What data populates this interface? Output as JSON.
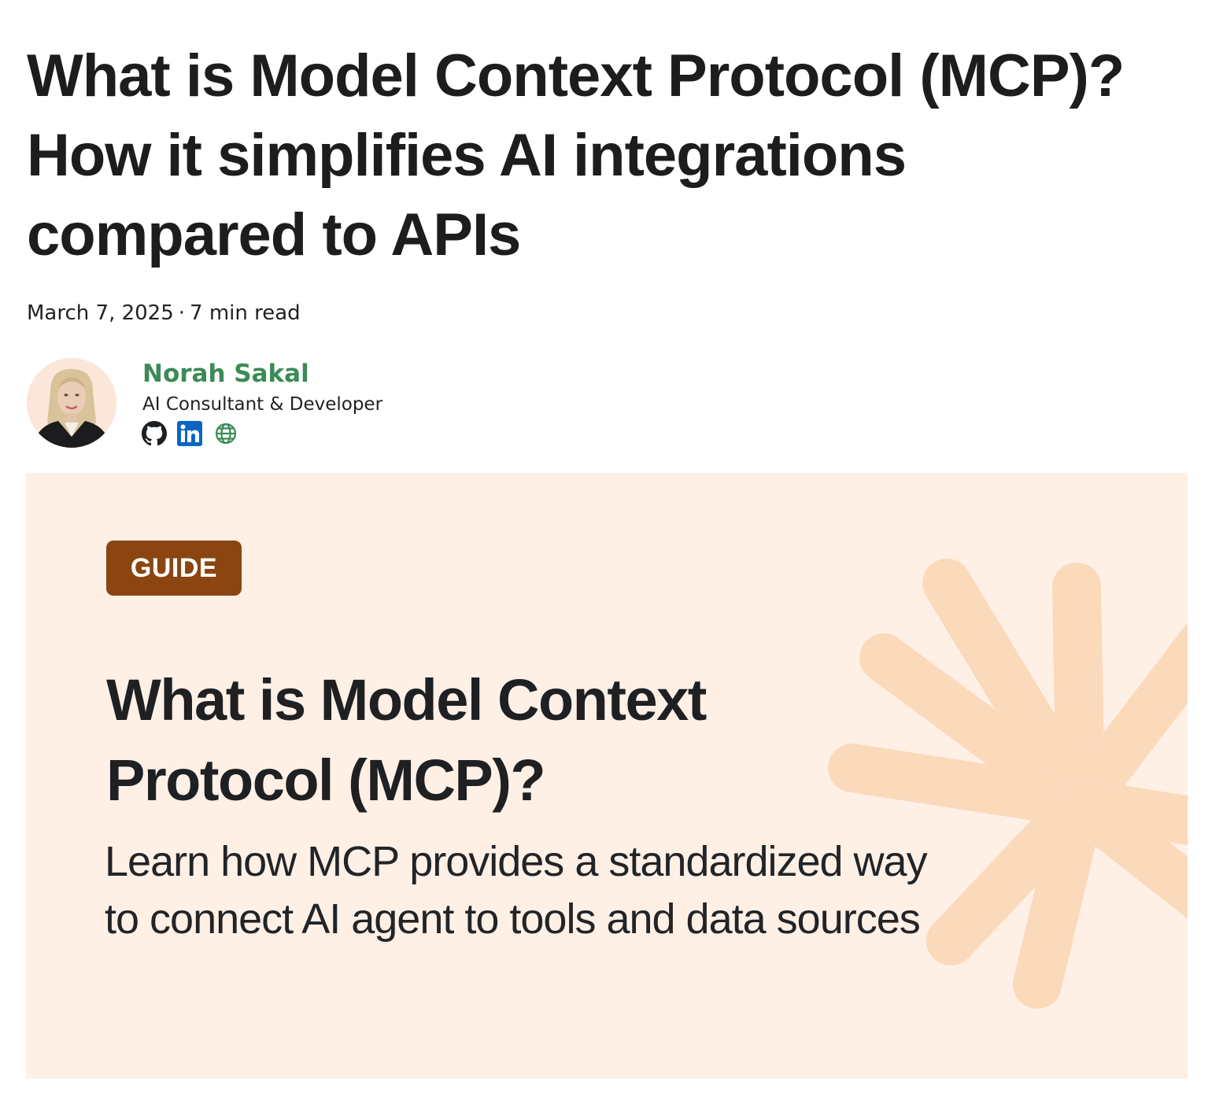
{
  "article": {
    "title": "What is Model Context Protocol (MCP)? How it simplifies AI integrations compared to APIs",
    "date": "March 7, 2025",
    "separator": "·",
    "read_time": "7 min read"
  },
  "author": {
    "name": "Norah Sakal",
    "role": "AI Consultant & Developer",
    "avatar_icon": "avatar",
    "links": [
      {
        "icon": "github-icon"
      },
      {
        "icon": "linkedin-icon"
      },
      {
        "icon": "globe-icon"
      }
    ]
  },
  "hero": {
    "badge": "GUIDE",
    "title": "What is Model Context Protocol (MCP)?",
    "subtitle": "Learn how MCP provides a standardized way to connect AI agent to tools and data sources",
    "background_color": "#fff0e6",
    "badge_color": "#8a4511",
    "burst_color": "#fbd9bb"
  },
  "colors": {
    "author_name": "#3b8a57",
    "linkedin": "#0a66c2",
    "globe": "#3b8a57",
    "text": "#1b1d1f"
  }
}
